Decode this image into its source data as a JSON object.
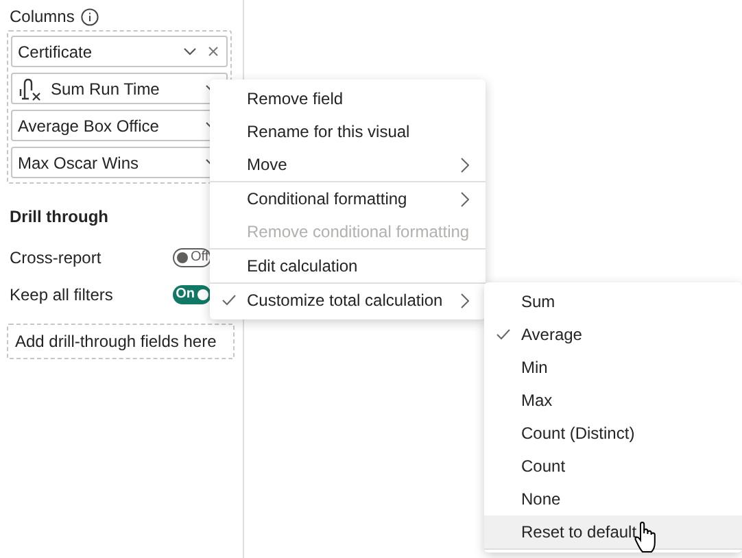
{
  "columns": {
    "title": "Columns",
    "fields": [
      {
        "label": "Certificate",
        "kind": "plain",
        "removable": true
      },
      {
        "label": "Sum Run Time",
        "kind": "calculation",
        "removable": false
      },
      {
        "label": "Average Box Office",
        "kind": "plain",
        "removable": false
      },
      {
        "label": "Max Oscar Wins",
        "kind": "plain",
        "removable": false
      }
    ]
  },
  "drill_through": {
    "title": "Drill through",
    "toggles": [
      {
        "label": "Cross-report",
        "on": false,
        "state_text": "Off"
      },
      {
        "label": "Keep all filters",
        "on": true,
        "state_text": "On"
      }
    ],
    "drop_zone": "Add drill-through fields here"
  },
  "context_menu": {
    "items": [
      {
        "label": "Remove field",
        "disabled": false,
        "checked": false,
        "submenu": false,
        "separator_after": false
      },
      {
        "label": "Rename for this visual",
        "disabled": false,
        "checked": false,
        "submenu": false,
        "separator_after": false
      },
      {
        "label": "Move",
        "disabled": false,
        "checked": false,
        "submenu": true,
        "separator_after": true
      },
      {
        "label": "Conditional formatting",
        "disabled": false,
        "checked": false,
        "submenu": true,
        "separator_after": false
      },
      {
        "label": "Remove conditional formatting",
        "disabled": true,
        "checked": false,
        "submenu": false,
        "separator_after": true
      },
      {
        "label": "Edit calculation",
        "disabled": false,
        "checked": false,
        "submenu": false,
        "separator_after": true
      },
      {
        "label": "Customize total calculation",
        "disabled": false,
        "checked": true,
        "submenu": true,
        "separator_after": false
      }
    ]
  },
  "submenu": {
    "items": [
      {
        "label": "Sum",
        "checked": false,
        "hovered": false
      },
      {
        "label": "Average",
        "checked": true,
        "hovered": false
      },
      {
        "label": "Min",
        "checked": false,
        "hovered": false
      },
      {
        "label": "Max",
        "checked": false,
        "hovered": false
      },
      {
        "label": "Count (Distinct)",
        "checked": false,
        "hovered": false
      },
      {
        "label": "Count",
        "checked": false,
        "hovered": false
      },
      {
        "label": "None",
        "checked": false,
        "hovered": false
      },
      {
        "label": "Reset to default",
        "checked": false,
        "hovered": true
      }
    ]
  }
}
